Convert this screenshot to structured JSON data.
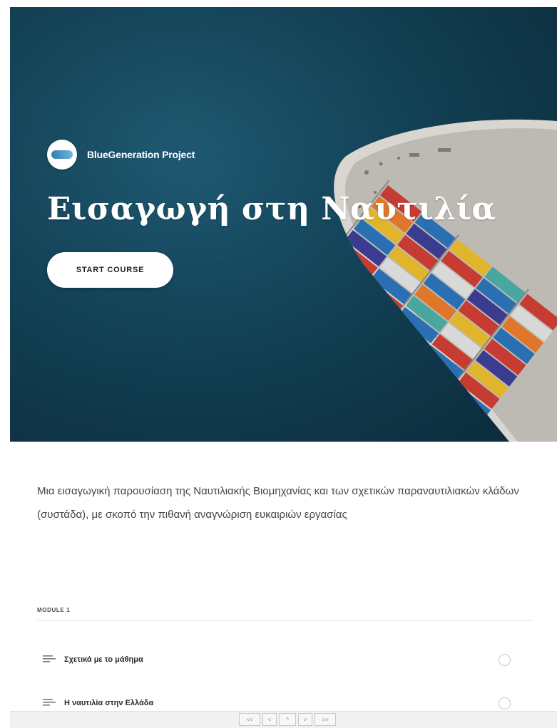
{
  "hero": {
    "brand_name": "BlueGeneration Project",
    "title": "Εισαγωγή στη Ναυτιλία",
    "start_button_label": "START COURSE",
    "background_color": "#154a61"
  },
  "course": {
    "description": "Μια εισαγωγική παρουσίαση της Ναυτιλιακής Βιομηχανίας και των σχετικών παραναυτιλιακών κλάδων (συστάδα), με σκοπό την πιθανή αναγνώριση ευκαιριών εργασίας"
  },
  "modules": [
    {
      "label": "MODULE 1",
      "lessons": [
        {
          "title": "Σχετικά με το μάθημα",
          "icon": "text-lines-icon",
          "completed": false
        },
        {
          "title": "Η ναυτιλία στην Ελλάδα",
          "icon": "text-lines-icon",
          "completed": false
        }
      ]
    }
  ],
  "pager": {
    "first": "<<",
    "prev": "<",
    "center": "^",
    "next": ">",
    "last": ">>"
  },
  "colors": {
    "sea": "#154a61",
    "button_bg": "#ffffff",
    "container_colors": [
      "#c63b32",
      "#e0b52c",
      "#2b6fb3",
      "#e0762a",
      "#3b3b8f",
      "#49a7a0",
      "#d9d9d9"
    ]
  }
}
